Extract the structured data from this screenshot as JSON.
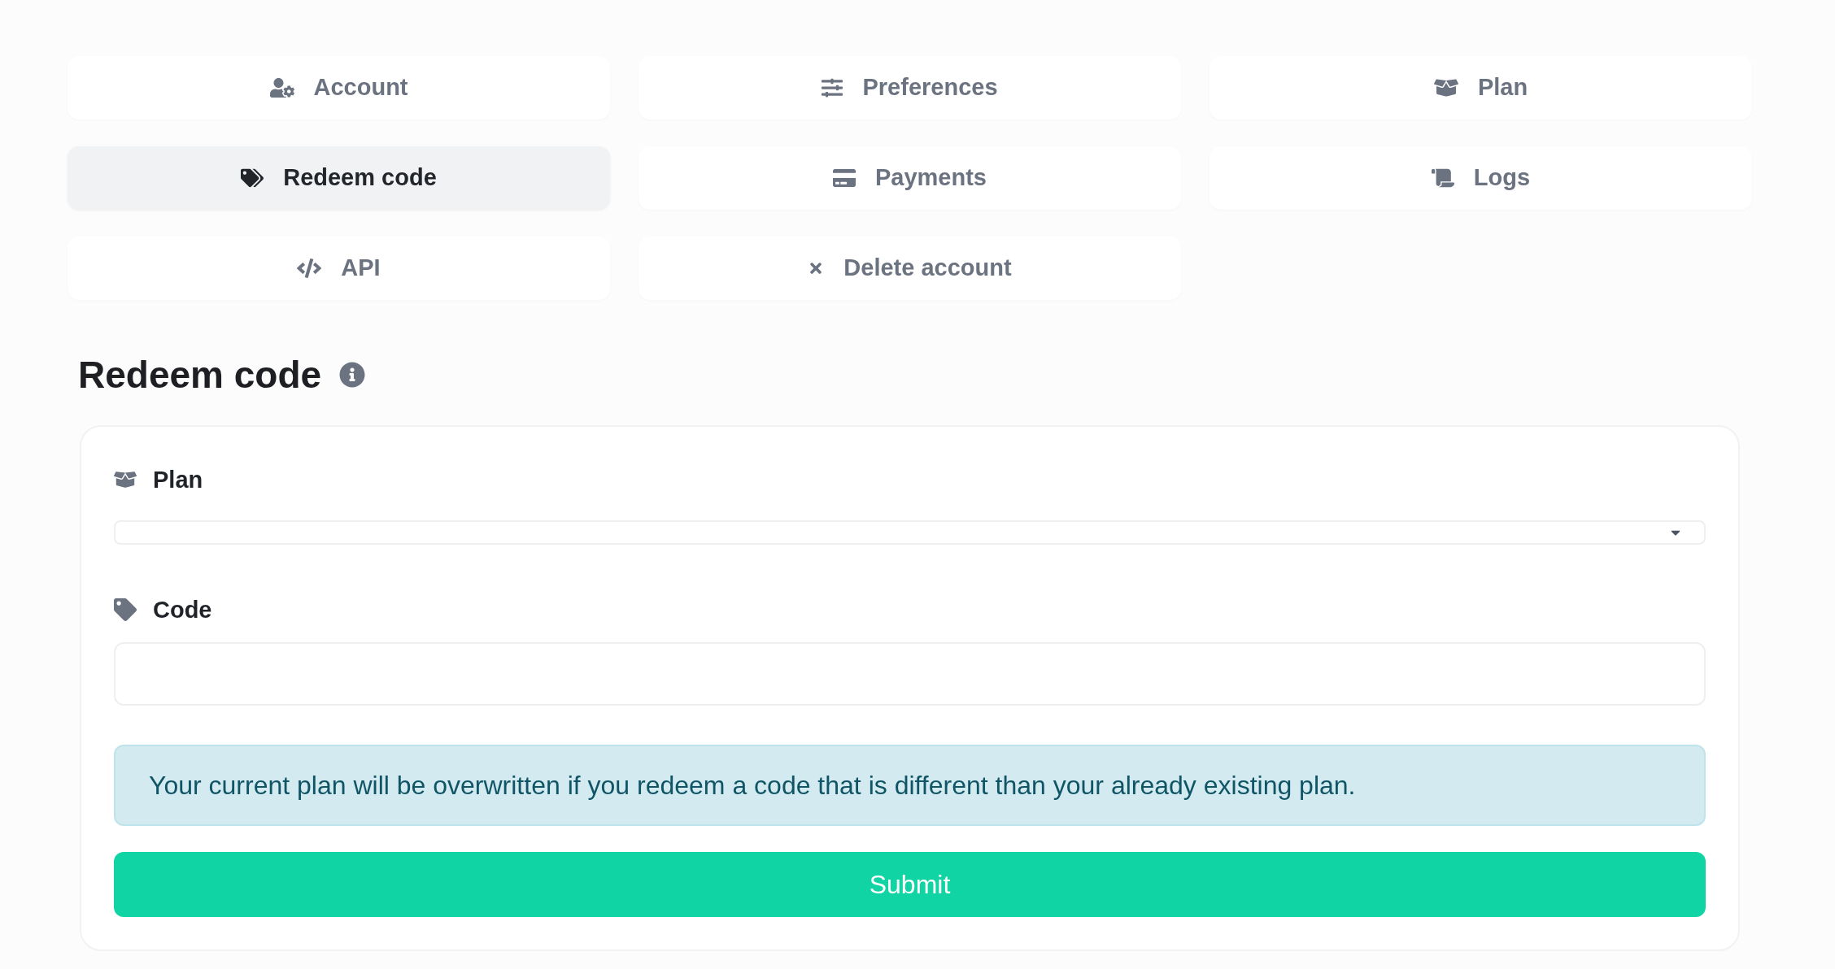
{
  "tabs": [
    {
      "label": "Account",
      "selected": false
    },
    {
      "label": "Preferences",
      "selected": false
    },
    {
      "label": "Plan",
      "selected": false
    },
    {
      "label": "Redeem code",
      "selected": true
    },
    {
      "label": "Payments",
      "selected": false
    },
    {
      "label": "Logs",
      "selected": false
    },
    {
      "label": "API",
      "selected": false
    },
    {
      "label": "Delete account",
      "selected": false
    }
  ],
  "section": {
    "title": "Redeem code"
  },
  "form": {
    "fields": [
      {
        "kind": "select",
        "label": "Plan"
      },
      {
        "kind": "text",
        "label": "Code"
      }
    ],
    "alert": "Your current plan will be overwritten if you redeem a code that is different than your already existing plan.",
    "submit": "Submit"
  }
}
